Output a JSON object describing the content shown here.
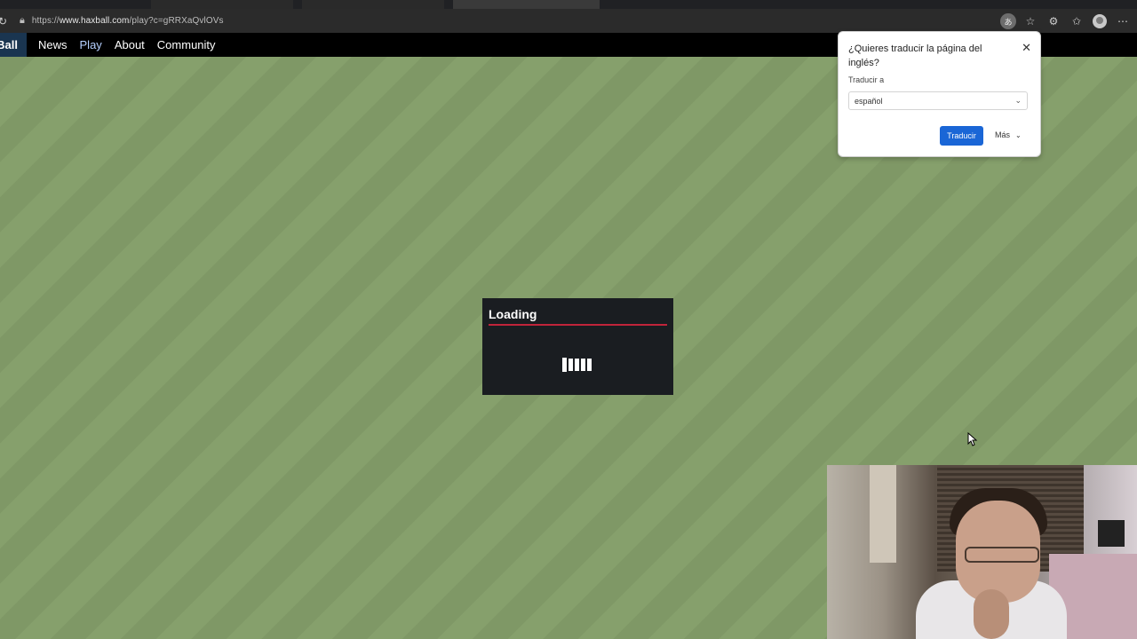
{
  "browser": {
    "url_prefix": "https://",
    "url_host": "www.haxball.com",
    "url_path": "/play?c=gRRXaQvlOVs"
  },
  "nav": {
    "brand": "Ball",
    "links": [
      "News",
      "Play",
      "About",
      "Community"
    ],
    "active": "Play"
  },
  "loading": {
    "title": "Loading"
  },
  "translate_popup": {
    "question": "¿Quieres traducir la página del inglés?",
    "target_label": "Traducir a",
    "target_language": "español",
    "translate_button": "Traducir",
    "more_button": "Más"
  },
  "colors": {
    "field": "#7f9866",
    "accent_red": "#c0243a",
    "translate_blue": "#1a66d6"
  },
  "icons": [
    "reload-icon",
    "lock-icon",
    "translate-icon",
    "star-icon",
    "extensions-icon",
    "favorites-icon",
    "profile-icon",
    "more-icon",
    "close-icon",
    "chevron-down-icon",
    "mouse-cursor-icon"
  ]
}
